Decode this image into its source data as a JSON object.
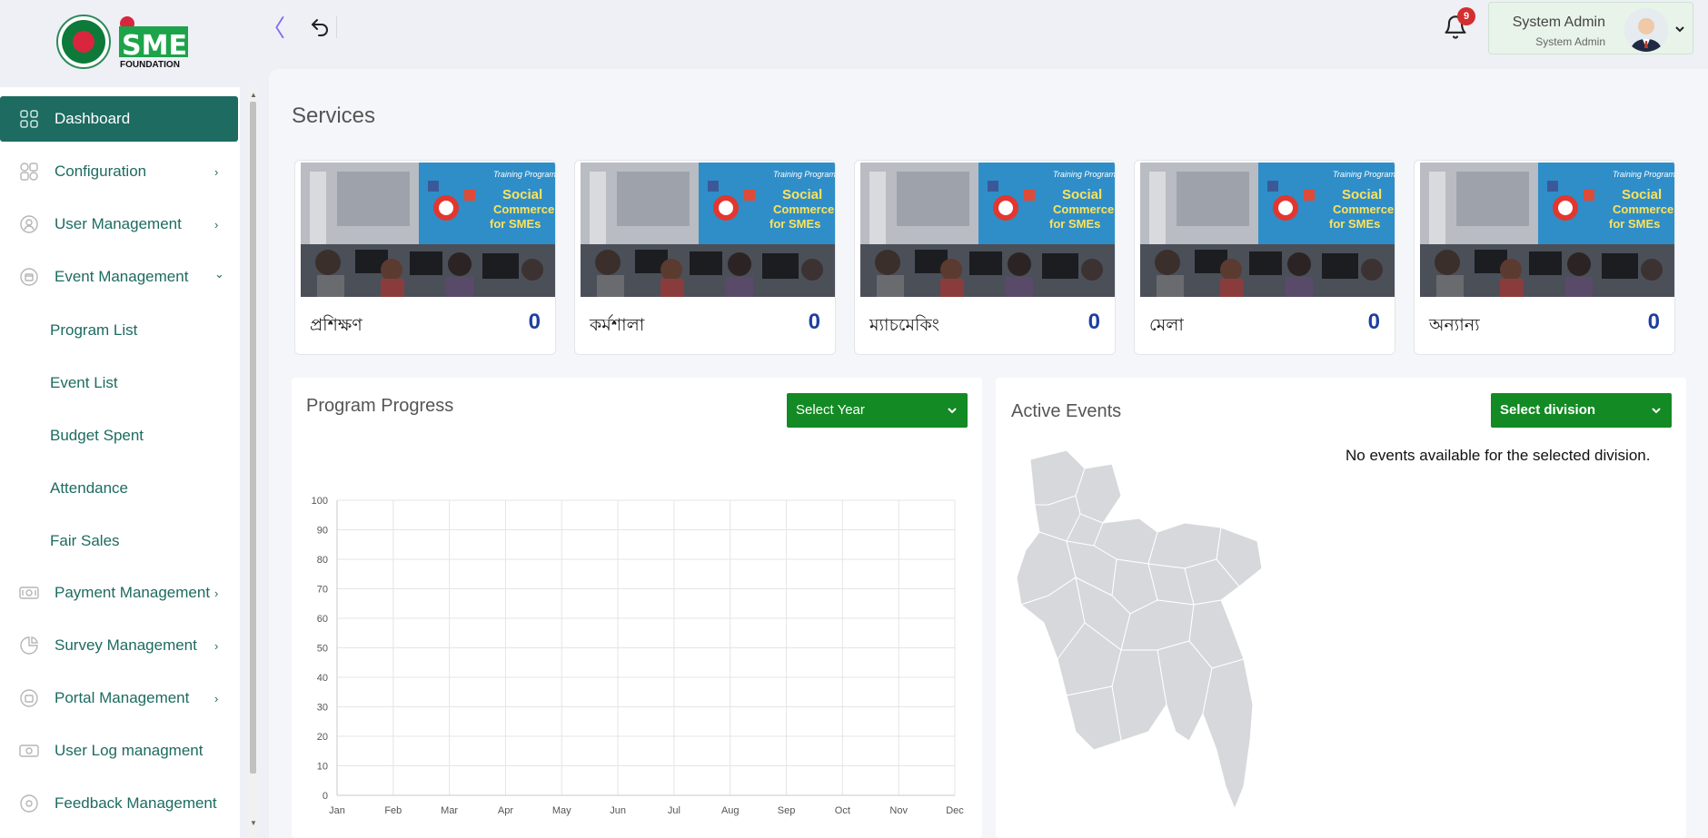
{
  "brand": {
    "logo_text": "SME",
    "logo_subtext": "FOUNDATION"
  },
  "topbar": {
    "notification_count": "9",
    "user": {
      "name": "System Admin",
      "role": "System Admin"
    }
  },
  "sidebar": {
    "items": [
      {
        "label": "Dashboard",
        "icon": "grid-icon",
        "active": true
      },
      {
        "label": "Configuration",
        "icon": "config-icon",
        "caret": "›"
      },
      {
        "label": "User Management",
        "icon": "user-circle-icon",
        "caret": "›"
      },
      {
        "label": "Event Management",
        "icon": "event-icon",
        "caret": "⌄"
      },
      {
        "label": "Payment Management",
        "icon": "payment-icon",
        "caret": "›"
      },
      {
        "label": "Survey Management",
        "icon": "pie-icon",
        "caret": "›"
      },
      {
        "label": "Portal Management",
        "icon": "portal-icon",
        "caret": "›"
      },
      {
        "label": "User Log managment",
        "icon": "log-icon"
      },
      {
        "label": "Feedback Management",
        "icon": "feedback-icon"
      }
    ],
    "event_subitems": [
      {
        "label": "Program List"
      },
      {
        "label": "Event List"
      },
      {
        "label": "Budget Spent"
      },
      {
        "label": "Attendance"
      },
      {
        "label": "Fair Sales"
      }
    ]
  },
  "services": {
    "title": "Services",
    "cards": [
      {
        "name": "প্রশিক্ষণ",
        "count": "0"
      },
      {
        "name": "কর্মশালা",
        "count": "0"
      },
      {
        "name": "ম্যাচমেকিং",
        "count": "0"
      },
      {
        "name": "মেলা",
        "count": "0"
      },
      {
        "name": "অন্যান্য",
        "count": "0"
      }
    ]
  },
  "program_progress": {
    "title": "Program Progress",
    "select_label": "Select Year"
  },
  "active_events": {
    "title": "Active Events",
    "select_label": "Select division",
    "empty_message": "No events available for the selected division."
  },
  "chart_data": {
    "type": "line",
    "title": "",
    "categories": [
      "Jan",
      "Feb",
      "Mar",
      "Apr",
      "May",
      "Jun",
      "Jul",
      "Aug",
      "Sep",
      "Oct",
      "Nov",
      "Dec"
    ],
    "series": [],
    "yticks": [
      0,
      10,
      20,
      30,
      40,
      50,
      60,
      70,
      80,
      90,
      100
    ],
    "ylim": [
      0,
      100
    ],
    "grid": true
  },
  "colors": {
    "primary_green": "#1d6b61",
    "select_green": "#138a24",
    "count_blue": "#1e3fa0",
    "badge_red": "#d32f2f"
  }
}
